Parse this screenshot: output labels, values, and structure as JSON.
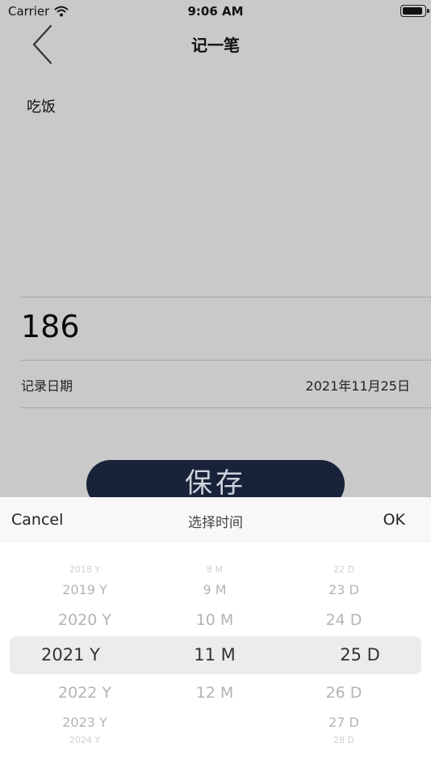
{
  "status_bar": {
    "carrier": "Carrier",
    "time": "9:06 AM",
    "battery_level": 0.95
  },
  "nav": {
    "title": "记一笔"
  },
  "record": {
    "category": "吃饭",
    "amount": "186",
    "date_label": "记录日期",
    "date_value": "2021年11月25日"
  },
  "save_label": "保存",
  "picker": {
    "cancel_label": "Cancel",
    "title": "选择时间",
    "ok_label": "OK",
    "years": [
      "2018 Y",
      "2019 Y",
      "2020 Y",
      "2021 Y",
      "2022 Y",
      "2023 Y",
      "2024 Y"
    ],
    "months": [
      "8 M",
      "9 M",
      "10 M",
      "11 M",
      "12 M"
    ],
    "days": [
      "22 D",
      "23 D",
      "24 D",
      "25 D",
      "26 D",
      "27 D",
      "28 D"
    ],
    "selected": {
      "year": "2021 Y",
      "month": "11 M",
      "day": "25 D"
    }
  },
  "colors": {
    "background": "#c9c9c9",
    "save_button": "#18233a",
    "picker_highlight": "#ececec"
  }
}
